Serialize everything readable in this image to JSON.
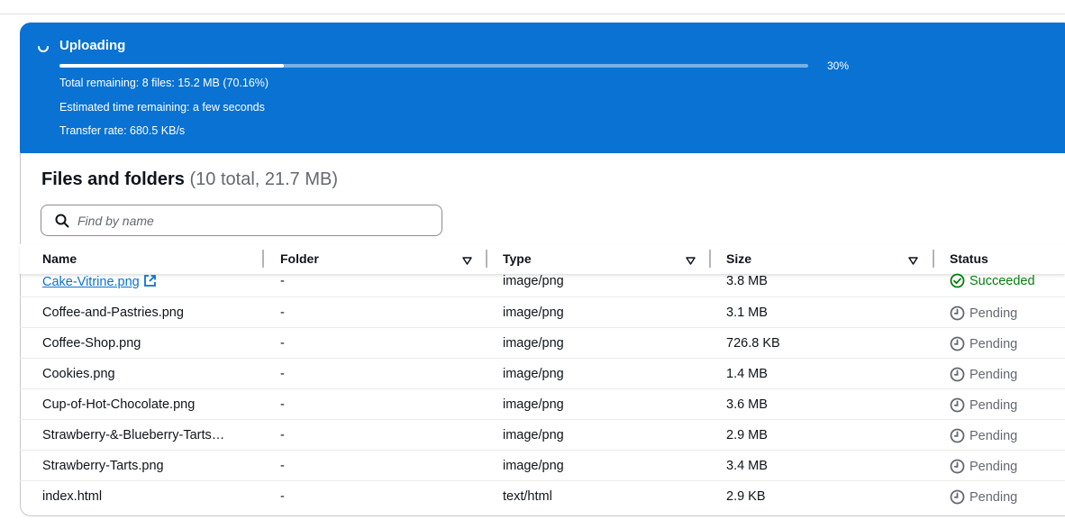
{
  "upload": {
    "title": "Uploading",
    "progress_fraction": 0.3,
    "progress_label": "30%",
    "total_remaining": "Total remaining: 8 files: 15.2 MB (70.16%)",
    "estimated_time": "Estimated time remaining: a few seconds",
    "transfer_rate": "Transfer rate: 680.5 KB/s"
  },
  "files": {
    "heading": "Files and folders",
    "count": "(10 total, 21.7 MB)",
    "search_placeholder": "Find by name",
    "columns": [
      "Name",
      "Folder",
      "Type",
      "Size",
      "Status"
    ],
    "rows": [
      {
        "name": "Cake-Vitrine.png",
        "folder": "-",
        "type": "image/png",
        "size": "3.8 MB",
        "status": "Succeeded",
        "link": true
      },
      {
        "name": "Coffee-and-Pastries.png",
        "folder": "-",
        "type": "image/png",
        "size": "3.1 MB",
        "status": "Pending"
      },
      {
        "name": "Coffee-Shop.png",
        "folder": "-",
        "type": "image/png",
        "size": "726.8 KB",
        "status": "Pending"
      },
      {
        "name": "Cookies.png",
        "folder": "-",
        "type": "image/png",
        "size": "1.4 MB",
        "status": "Pending"
      },
      {
        "name": "Cup-of-Hot-Chocolate.png",
        "folder": "-",
        "type": "image/png",
        "size": "3.6 MB",
        "status": "Pending"
      },
      {
        "name": "Strawberry-&-Blueberry-Tarts…",
        "folder": "-",
        "type": "image/png",
        "size": "2.9 MB",
        "status": "Pending"
      },
      {
        "name": "Strawberry-Tarts.png",
        "folder": "-",
        "type": "image/png",
        "size": "3.4 MB",
        "status": "Pending"
      },
      {
        "name": "index.html",
        "folder": "-",
        "type": "text/html",
        "size": "2.9 KB",
        "status": "Pending"
      }
    ]
  },
  "colors": {
    "banner": "#0972d3",
    "link": "#0972d3",
    "success": "#037f0c",
    "pending": "#656871"
  },
  "icons": {
    "spinner": "spinner-icon",
    "search": "search-icon",
    "sort": "caret-down-icon",
    "external": "external-link-icon",
    "succeeded": "check-circle-icon",
    "pending": "clock-icon"
  }
}
